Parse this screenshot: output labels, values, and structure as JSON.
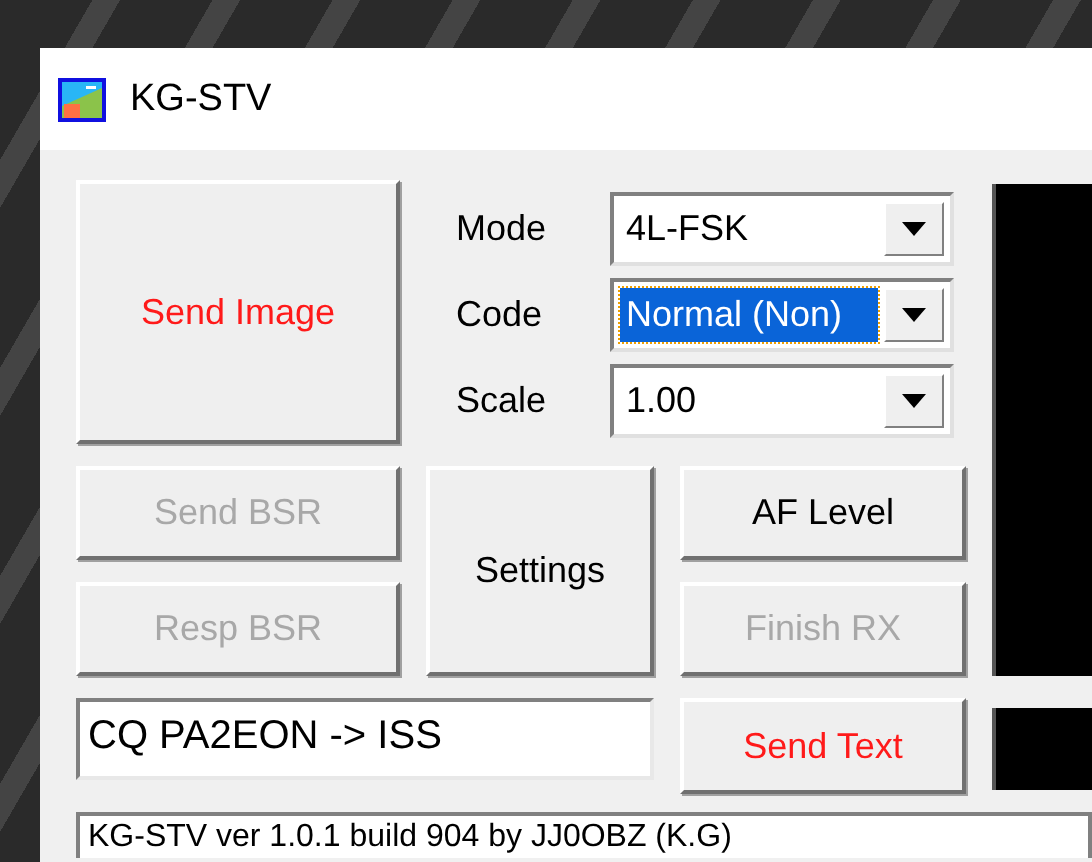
{
  "window": {
    "title": "KG-STV"
  },
  "send_image": {
    "label": "Send Image",
    "accent": true,
    "disabled": false
  },
  "selects": [
    {
      "label": "Mode",
      "value": "4L-FSK",
      "focused": false
    },
    {
      "label": "Code",
      "value": "Normal (Non)",
      "focused": true
    },
    {
      "label": "Scale",
      "value": "1.00",
      "focused": false
    }
  ],
  "buttons": [
    {
      "label": "Send BSR",
      "accent": false,
      "disabled": true
    },
    {
      "label": "Settings",
      "accent": false,
      "disabled": false
    },
    {
      "label": "AF Level",
      "accent": false,
      "disabled": false
    },
    {
      "label": "Resp BSR",
      "accent": false,
      "disabled": true
    },
    {
      "label": "Finish RX",
      "accent": false,
      "disabled": true
    }
  ],
  "message_field": {
    "value": "CQ PA2EON -> ISS"
  },
  "send_text": {
    "label": "Send Text",
    "accent": true,
    "disabled": false
  },
  "status_bar": {
    "text": "KG-STV ver 1.0.1 build 904 by JJ0OBZ (K.G)"
  }
}
